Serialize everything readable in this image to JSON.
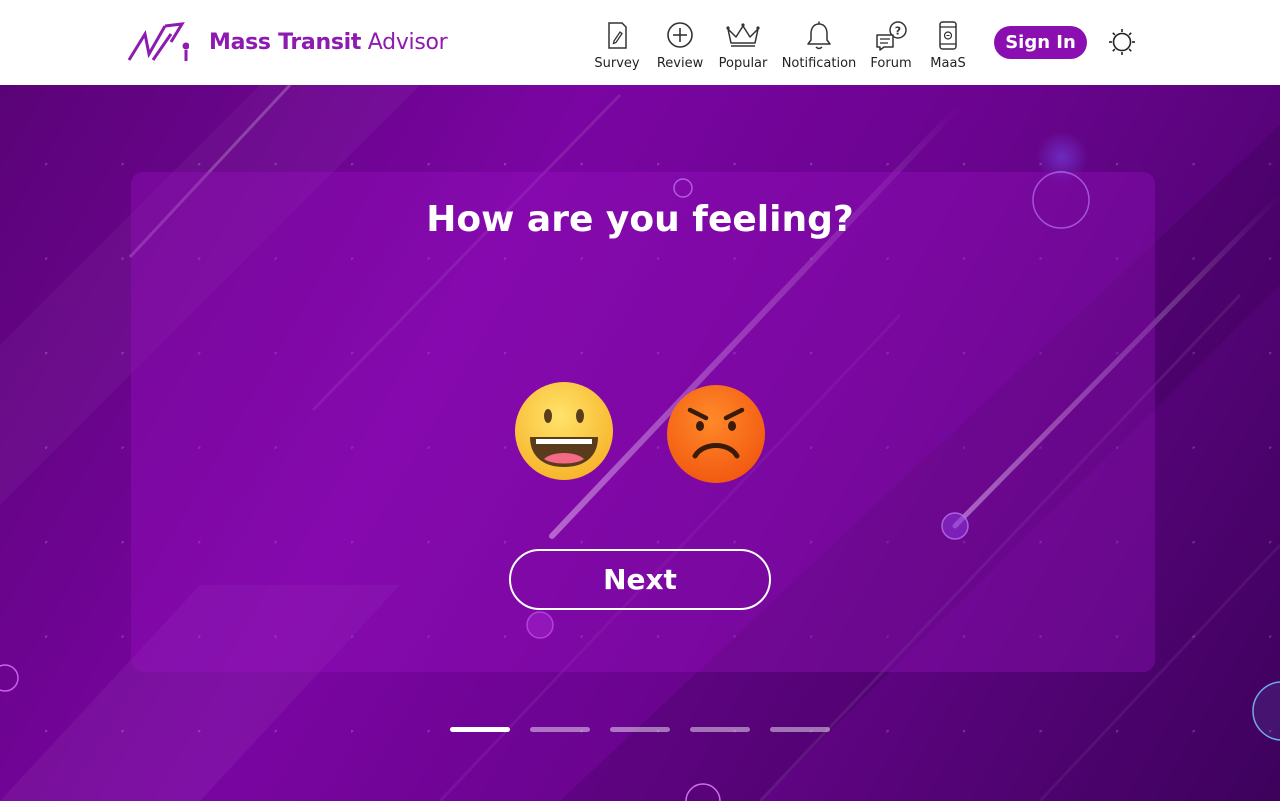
{
  "brand": {
    "name_bold": "Mass Transit",
    "name_light": "Advisor"
  },
  "nav": [
    {
      "id": "survey",
      "label": "Survey",
      "icon": "survey-icon"
    },
    {
      "id": "review",
      "label": "Review",
      "icon": "plus-circle-icon"
    },
    {
      "id": "popular",
      "label": "Popular",
      "icon": "crown-icon"
    },
    {
      "id": "notification",
      "label": "Notification",
      "icon": "bell-icon"
    },
    {
      "id": "forum",
      "label": "Forum",
      "icon": "chat-question-icon"
    },
    {
      "id": "maas",
      "label": "MaaS",
      "icon": "phone-icon"
    }
  ],
  "auth": {
    "signin_label": "Sign In"
  },
  "theme": {
    "icon": "sun-icon"
  },
  "survey": {
    "question": "How are you feeling?",
    "options": [
      {
        "id": "happy",
        "icon": "happy-face-icon"
      },
      {
        "id": "angry",
        "icon": "angry-face-icon"
      }
    ],
    "next_label": "Next",
    "steps_total": 5,
    "current_step": 1
  },
  "colors": {
    "brand": "#8e1bb0",
    "hero_bg": "#7a05a2",
    "button": "#8b0fb0"
  }
}
